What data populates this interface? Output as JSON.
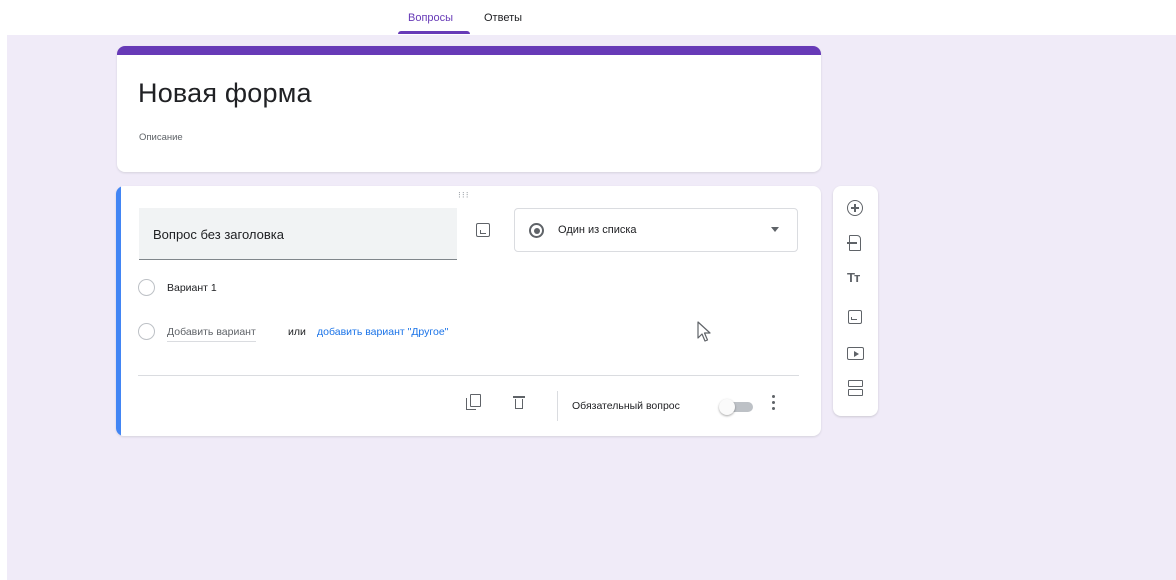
{
  "tabs": {
    "questions": "Вопросы",
    "responses": "Ответы",
    "active": "questions"
  },
  "form": {
    "title": "Новая форма",
    "description_placeholder": "Описание"
  },
  "question": {
    "title_placeholder": "Вопрос без заголовка",
    "type": "Один из списка",
    "options": [
      "Вариант 1"
    ],
    "add_option": "Добавить вариант",
    "or": "или",
    "add_other": "добавить вариант \"Другое\"",
    "required_label": "Обязательный вопрос",
    "required": false
  },
  "toolbar": {
    "add_question_icon": "add-circle-icon",
    "import_icon": "import-questions-icon",
    "title_glyph": "Tт",
    "image_icon": "image-icon",
    "video_icon": "video-icon",
    "section_icon": "section-icon"
  },
  "colors": {
    "theme": "#673ab7",
    "background": "#f0ebf8",
    "active_question": "#4285f4",
    "link": "#1a73e8"
  }
}
